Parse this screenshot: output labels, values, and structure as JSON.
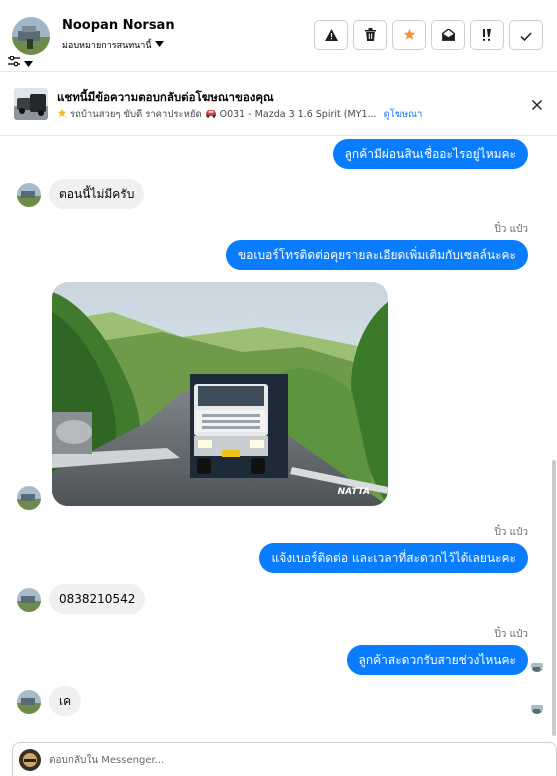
{
  "header": {
    "contact_name": "Noopan Norsan",
    "assign_label": "มอบหมายการสนทนานี้",
    "toolbar": {
      "icons": [
        "warning-icon",
        "trash-icon",
        "star-icon",
        "mark-unread-icon",
        "priority-icon",
        "check-icon"
      ],
      "star_color": "#f7923a"
    }
  },
  "ad_banner": {
    "title": "แชทนี้มีข้อความตอบกลับต่อโฆษณาของคุณ",
    "subtitle": "รถบ้านสวยๆ ขับดี ราคาประหยัด",
    "car_text": "O031 - Mazda 3 1.6 Spirit (MY1...",
    "link_label": "ดูโฆษณา"
  },
  "messages": {
    "m1": "ลูกค้ามีผ่อนสินเชื่ออะไรอยู่ไหมคะ",
    "m2": "ตอนนี้ไม่มีครับ",
    "m3_sender": "ปิ๋ว แป๋ว",
    "m3": "ขอเบอร์โทรติดต่อคุยรายละเอียดเพิ่มเติมกับเซลล์นะคะ",
    "m4_photo_watermark": "NATTA",
    "m5_sender": "ปิ๋ว แป๋ว",
    "m5": "แจ้งเบอร์ติดต่อ  และเวลาที่สะดวกไว้ได้เลยนะคะ",
    "m6": "0838210542",
    "m7_sender": "ปิ๋ว แป๋ว",
    "m7": "ลูกค้าสะดวกรับสายช่วงไหนคะ",
    "m8": "เค"
  },
  "colors": {
    "outgoing_bubble": "#0a7cff",
    "incoming_bubble": "#f0f0f0",
    "link": "#1877f2"
  },
  "composer": {
    "placeholder": "ตอบกลับใน Messenger..."
  }
}
